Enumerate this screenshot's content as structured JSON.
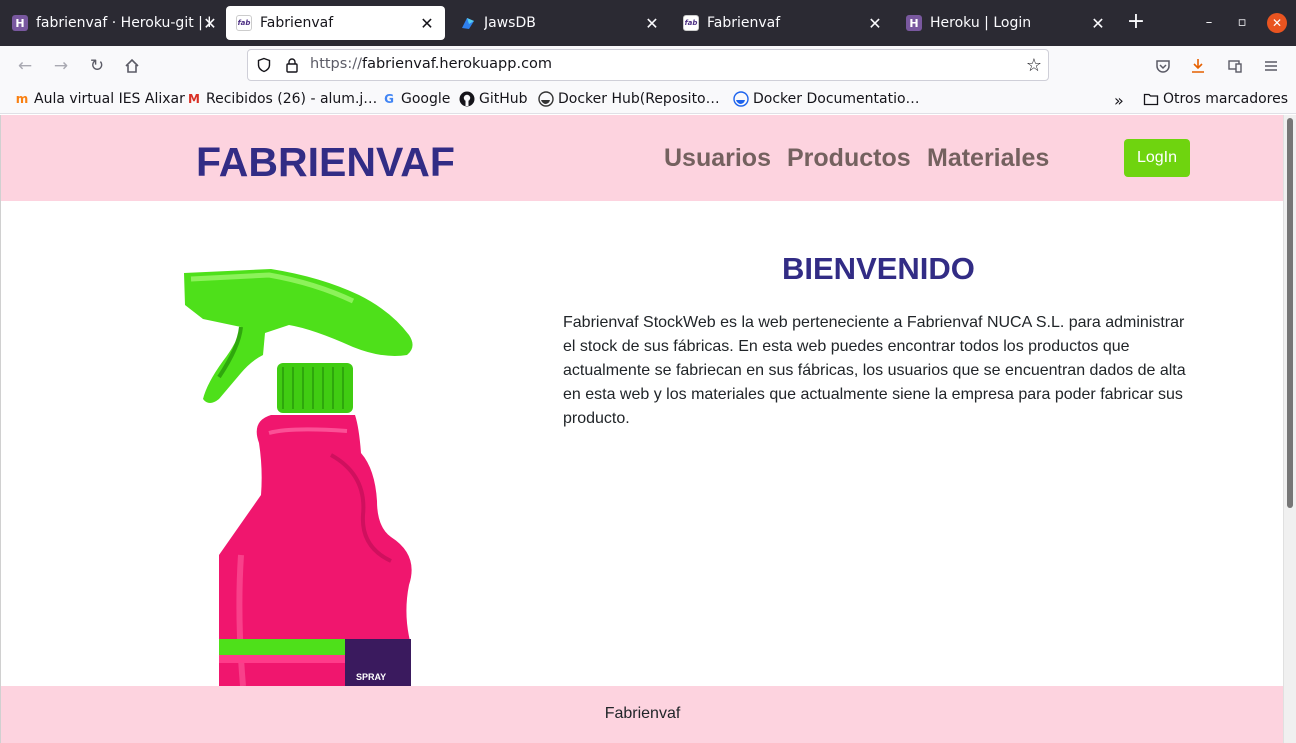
{
  "browser": {
    "tabs": [
      {
        "title": "fabrienvaf · Heroku-git | H",
        "favicon": "heroku-icon",
        "active": false
      },
      {
        "title": "Fabrienvaf",
        "favicon": "fabrienvaf-icon",
        "active": true
      },
      {
        "title": "JawsDB",
        "favicon": "jawsdb-icon",
        "active": false
      },
      {
        "title": "Fabrienvaf",
        "favicon": "fabrienvaf-icon",
        "active": false
      },
      {
        "title": "Heroku | Login",
        "favicon": "heroku-icon",
        "active": false
      }
    ],
    "url_protocol": "https://",
    "url_host": "fabrienvaf.herokuapp.com",
    "bookmarks": [
      {
        "label": "Aula virtual IES Alixar",
        "icon": "moodle-icon"
      },
      {
        "label": "Recibidos (26) - alum.j…",
        "icon": "gmail-icon"
      },
      {
        "label": "Google",
        "icon": "google-icon"
      },
      {
        "label": "GitHub",
        "icon": "github-icon"
      },
      {
        "label": "Docker Hub(Reposito…",
        "icon": "docker-icon"
      },
      {
        "label": "Docker Documentatio…",
        "icon": "docker-icon"
      }
    ],
    "other_bookmarks": "Otros marcadores"
  },
  "site": {
    "brand": "FABRIENVAF",
    "nav": [
      "Usuarios",
      "Productos",
      "Materiales"
    ],
    "login_label": "LogIn",
    "welcome_title": "BIENVENIDO",
    "description": "Fabrienvaf StockWeb es la web perteneciente a Fabrienvaf NUCA S.L. para administrar el stock de sus fábricas. En esta web puedes encontrar todos los productos que actualmente se fabriecan en sus fábricas, los usuarios que se encuentran dados de alta en esta web y los materiales que actualmente siene la empresa para poder fabricar sus producto.",
    "product_label": "SPRAY",
    "footer": "Fabrienvaf"
  },
  "colors": {
    "header_bg": "#fdd3df",
    "brand": "#322c85",
    "nav_text": "#74615f",
    "login_bg": "#6fd40f",
    "bottle_pink": "#f0166e",
    "trigger_green": "#4ee01a"
  }
}
